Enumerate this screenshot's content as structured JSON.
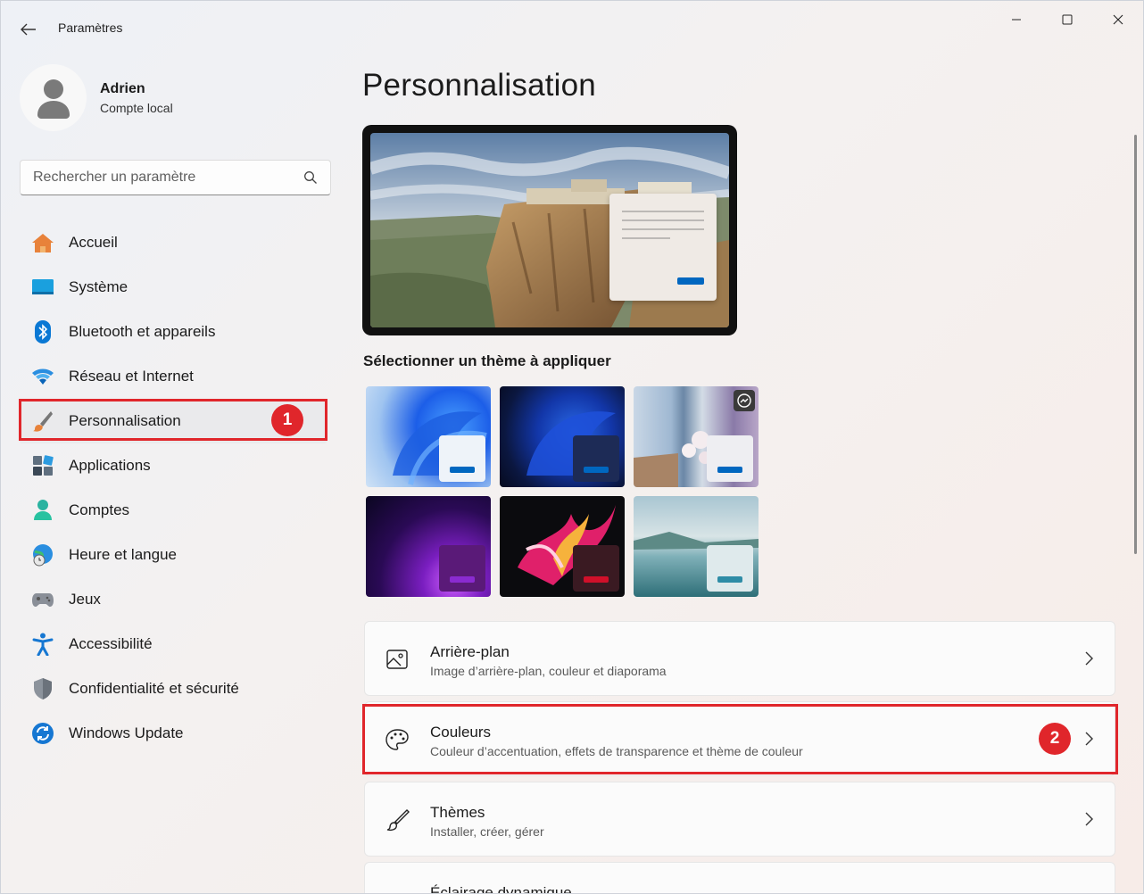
{
  "window": {
    "title": "Paramètres",
    "controls": [
      "minimize",
      "maximize",
      "close"
    ]
  },
  "user": {
    "name": "Adrien",
    "account_type": "Compte local"
  },
  "search": {
    "placeholder": "Rechercher un paramètre"
  },
  "sidebar": {
    "items": [
      {
        "label": "Accueil",
        "icon": "home-icon"
      },
      {
        "label": "Système",
        "icon": "system-icon"
      },
      {
        "label": "Bluetooth et appareils",
        "icon": "bluetooth-icon"
      },
      {
        "label": "Réseau et Internet",
        "icon": "wifi-icon"
      },
      {
        "label": "Personnalisation",
        "icon": "paintbrush-icon",
        "selected": true
      },
      {
        "label": "Applications",
        "icon": "apps-icon"
      },
      {
        "label": "Comptes",
        "icon": "person-icon"
      },
      {
        "label": "Heure et langue",
        "icon": "globe-clock-icon"
      },
      {
        "label": "Jeux",
        "icon": "gamepad-icon"
      },
      {
        "label": "Accessibilité",
        "icon": "accessibility-icon"
      },
      {
        "label": "Confidentialité et sécurité",
        "icon": "shield-icon"
      },
      {
        "label": "Windows Update",
        "icon": "update-icon"
      }
    ]
  },
  "annotations": {
    "badge1": "1",
    "badge2": "2",
    "color": "#e0262b"
  },
  "main": {
    "title": "Personnalisation",
    "theme_section_label": "Sélectionner un thème à appliquer",
    "themes": [
      {
        "name": "windows-light",
        "accent": "#0067c0"
      },
      {
        "name": "windows-dark",
        "accent": "#0067c0"
      },
      {
        "name": "flower",
        "accent": "#0067c0"
      },
      {
        "name": "glow",
        "accent": "#8a2bd0"
      },
      {
        "name": "captured-motion",
        "accent": "#d0102a"
      },
      {
        "name": "sunrise",
        "accent": "#2e8ca6"
      }
    ],
    "cards": [
      {
        "title": "Arrière-plan",
        "subtitle": "Image d’arrière-plan, couleur et diaporama",
        "icon": "image-icon"
      },
      {
        "title": "Couleurs",
        "subtitle": "Couleur d’accentuation, effets de transparence et thème de couleur",
        "icon": "palette-icon"
      },
      {
        "title": "Thèmes",
        "subtitle": "Installer, créer, gérer",
        "icon": "brush-icon"
      },
      {
        "title": "Éclairage dynamique",
        "subtitle": "",
        "icon": "lighting-icon"
      }
    ]
  }
}
